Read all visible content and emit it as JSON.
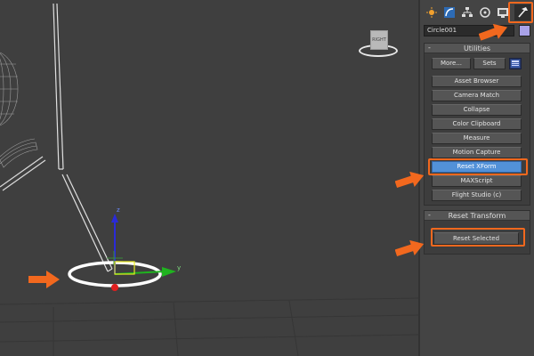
{
  "viewport": {
    "viewcube_label": "RIGHT",
    "gizmo": {
      "y_axis": "y",
      "z_axis": "z"
    }
  },
  "panel": {
    "tabs": [
      {
        "name": "create",
        "icon": "sun-icon"
      },
      {
        "name": "modify",
        "icon": "modify-icon"
      },
      {
        "name": "hierarchy",
        "icon": "hierarchy-icon"
      },
      {
        "name": "motion",
        "icon": "motion-icon"
      },
      {
        "name": "display",
        "icon": "display-icon"
      },
      {
        "name": "utilities",
        "icon": "hammer-icon",
        "active": true
      }
    ],
    "object_name": "Circle001",
    "object_color": "#a9a2e8",
    "utilities": {
      "title": "Utilities",
      "toggle": "-",
      "more_label": "More...",
      "sets_label": "Sets",
      "items": [
        "Asset Browser",
        "Camera Match",
        "Collapse",
        "Color Clipboard",
        "Measure",
        "Motion Capture",
        "Reset XForm",
        "MAXScript",
        "Flight Studio (c)"
      ],
      "selected_item": "Reset XForm"
    },
    "reset_transform": {
      "title": "Reset Transform",
      "toggle": "-",
      "button_label": "Reset Selected"
    }
  },
  "colors": {
    "highlight": "#f2681e",
    "selected_button": "#5291d8",
    "viewport_bg": "#3f3f3f",
    "panel_bg": "#444444"
  }
}
